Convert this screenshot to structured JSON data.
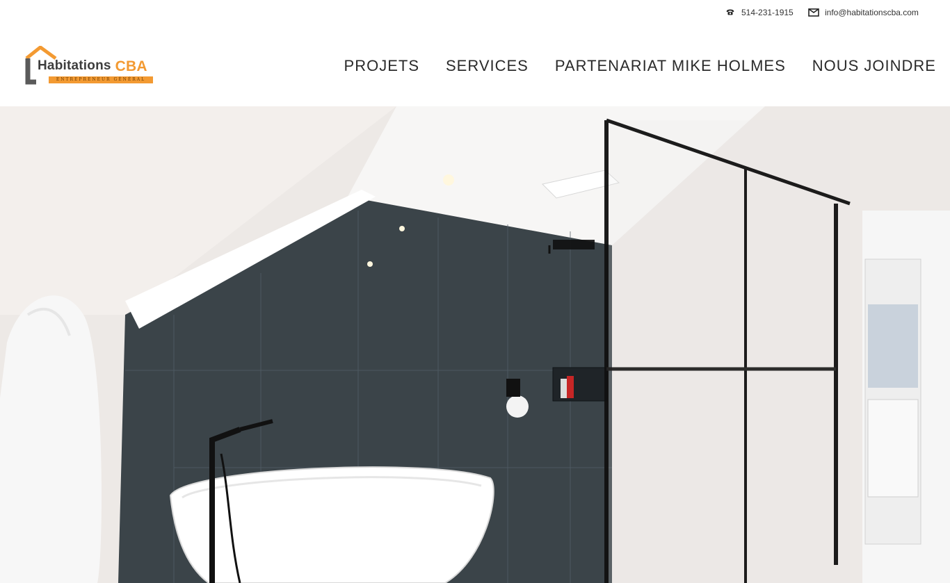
{
  "header": {
    "phone": "514-231-1915",
    "email": "info@habitationscba.com"
  },
  "logo": {
    "word": "Habitations",
    "brand": "CBA",
    "tagline": "ENTREPRENEUR GÉNÉRAL",
    "brand_color": "#f39a32"
  },
  "nav": {
    "items": [
      {
        "label": "PROJETS"
      },
      {
        "label": "SERVICES"
      },
      {
        "label": "PARTENARIAT MIKE HOLMES"
      },
      {
        "label": "NOUS JOINDRE"
      }
    ]
  },
  "icons": {
    "phone": "phone-icon",
    "email": "envelope-icon"
  }
}
